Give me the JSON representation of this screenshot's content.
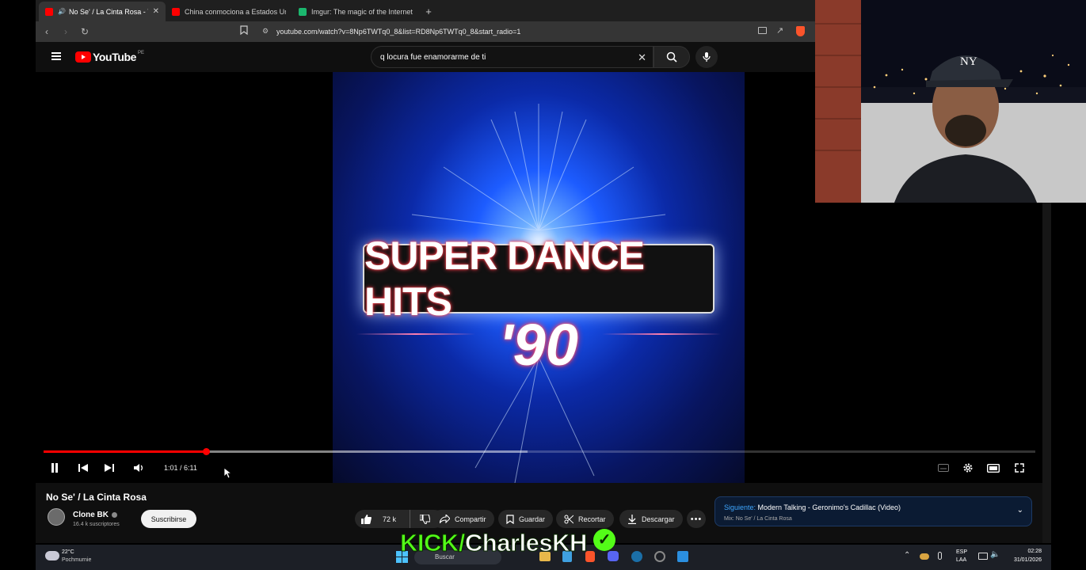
{
  "browser": {
    "tabs": [
      {
        "title": "No Se' / La Cinta Rosa - YouT",
        "active": true,
        "favicon_color": "#ff0000",
        "audio": true
      },
      {
        "title": "China conmociona a Estados Unidos",
        "active": false,
        "favicon_color": "#ff0000"
      },
      {
        "title": "Imgur: The magic of the Internet",
        "active": false,
        "favicon_color": "#1bb76e"
      }
    ],
    "url": "youtube.com/watch?v=8Np6TWTq0_8&list=RD8Np6TWTq0_8&start_radio=1"
  },
  "youtube": {
    "logo_text": "YouTube",
    "country_code": "PE",
    "search_query": "q locura fue enamorarme de ti",
    "accent": "#ff0000"
  },
  "player": {
    "artwork_title": "SUPER DANCE HITS",
    "artwork_subtitle": "'90",
    "time_display": "1:01 / 6:11",
    "progress_fraction": 0.164,
    "buffer_fraction": 0.488
  },
  "video": {
    "title": "No Se' / La Cinta Rosa",
    "channel": "Clone BK",
    "subscribers": "16.4 k suscriptores",
    "subscribe_label": "Suscribirse",
    "likes": "72 k",
    "share_label": "Compartir",
    "save_label": "Guardar",
    "clip_label": "Recortar",
    "download_label": "Descargar"
  },
  "up_next": {
    "label": "Siguiente:",
    "title": "Modern Talking - Geronimo's Cadillac (Video)",
    "mix": "Mix: No Se' / La Cinta Rosa"
  },
  "overlay": {
    "kick_prefix": "KICK/",
    "kick_name": "CharlesKH"
  },
  "taskbar": {
    "weather_temp": "22°C",
    "weather_place": "Pochmurnie",
    "search_label": "Buscar",
    "lang_top": "ESP",
    "lang_bottom": "LAA",
    "clock_time": "02:28",
    "clock_date": "31/01/2026"
  }
}
